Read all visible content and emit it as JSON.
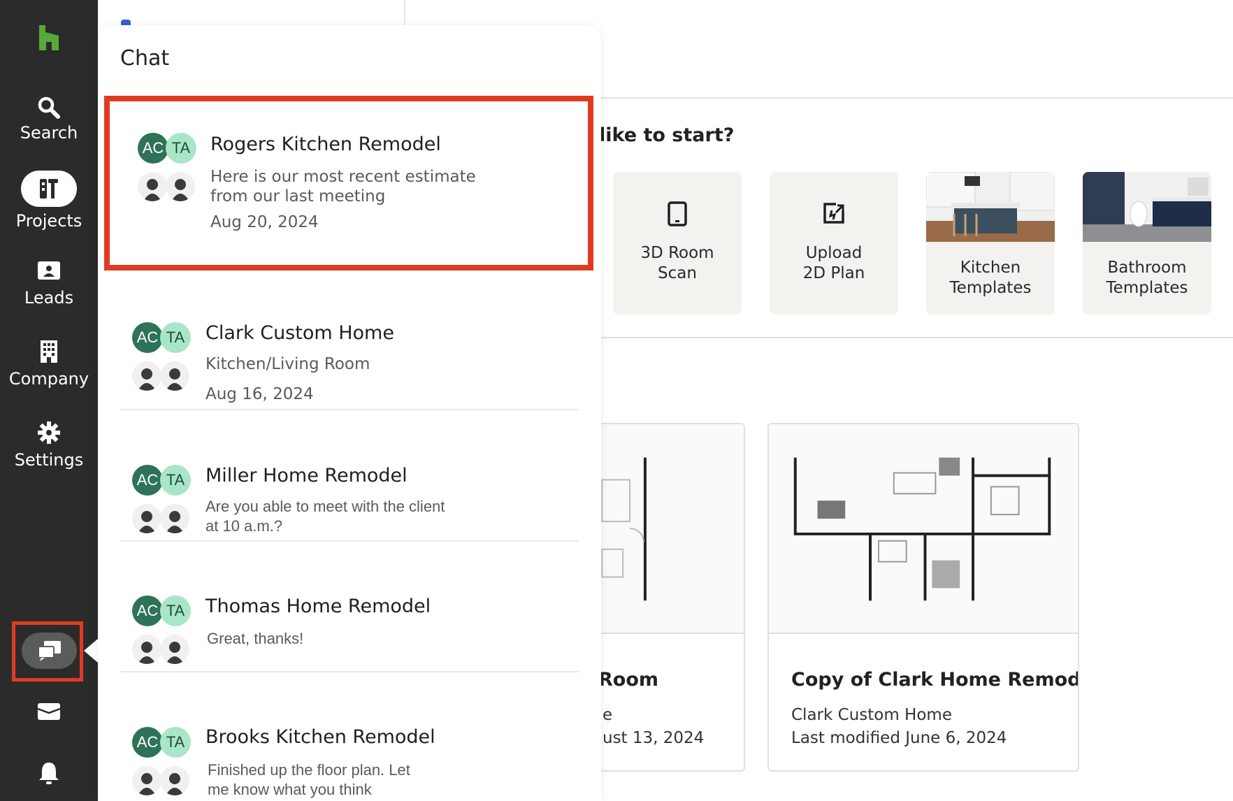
{
  "sidebar": {
    "items": [
      {
        "label": "Search",
        "icon": "search-icon"
      },
      {
        "label": "Projects",
        "icon": "projects-icon"
      },
      {
        "label": "Leads",
        "icon": "leads-icon"
      },
      {
        "label": "Company",
        "icon": "company-icon"
      },
      {
        "label": "Settings",
        "icon": "gear-icon"
      }
    ],
    "bottom_icons": [
      "chat-icon",
      "inbox-icon",
      "bell-icon"
    ]
  },
  "main": {
    "question": "like to start?",
    "tiles": [
      {
        "line1": "3D Room",
        "line2": "Scan",
        "icon": "phone-icon"
      },
      {
        "line1": "Upload",
        "line2": "2D Plan",
        "icon": "upload-plan-icon"
      },
      {
        "line1": "Kitchen",
        "line2": "Templates",
        "icon": "kitchen-photo"
      },
      {
        "line1": "Bathroom",
        "line2": "Templates",
        "icon": "bathroom-photo"
      }
    ],
    "cards": [
      {
        "title": "Room",
        "sub1": "e",
        "sub2": "ust 13, 2024"
      },
      {
        "title": "Copy of Clark Home Remod...",
        "sub1": "Clark Custom Home",
        "sub2": "Last modified June 6, 2024"
      }
    ]
  },
  "chat": {
    "title": "Chat",
    "avatar_ac": "AC",
    "avatar_ta": "TA",
    "conversations": [
      {
        "title": "Rogers Kitchen Remodel",
        "message": "Here is our most recent estimate\nfrom our last meeting",
        "date": "Aug 20, 2024"
      },
      {
        "title": "Clark Custom Home",
        "message": "Kitchen/Living Room",
        "date": "Aug 16, 2024"
      },
      {
        "title": "Miller Home Remodel",
        "message": "Are you able to meet with the client\nat 10 a.m.?",
        "date": ""
      },
      {
        "title": "Thomas Home Remodel",
        "message": "Great, thanks!",
        "date": ""
      },
      {
        "title": "Brooks Kitchen Remodel",
        "message": "Finished up the floor plan. Let\nme know what you think",
        "date": ""
      }
    ]
  },
  "colors": {
    "sidebar_bg": "#2b2b2b",
    "brand_green": "#5aa83c",
    "highlight_red": "#e03b22",
    "avatar_ac": "#2e7357",
    "avatar_ta": "#a9e6c8"
  }
}
